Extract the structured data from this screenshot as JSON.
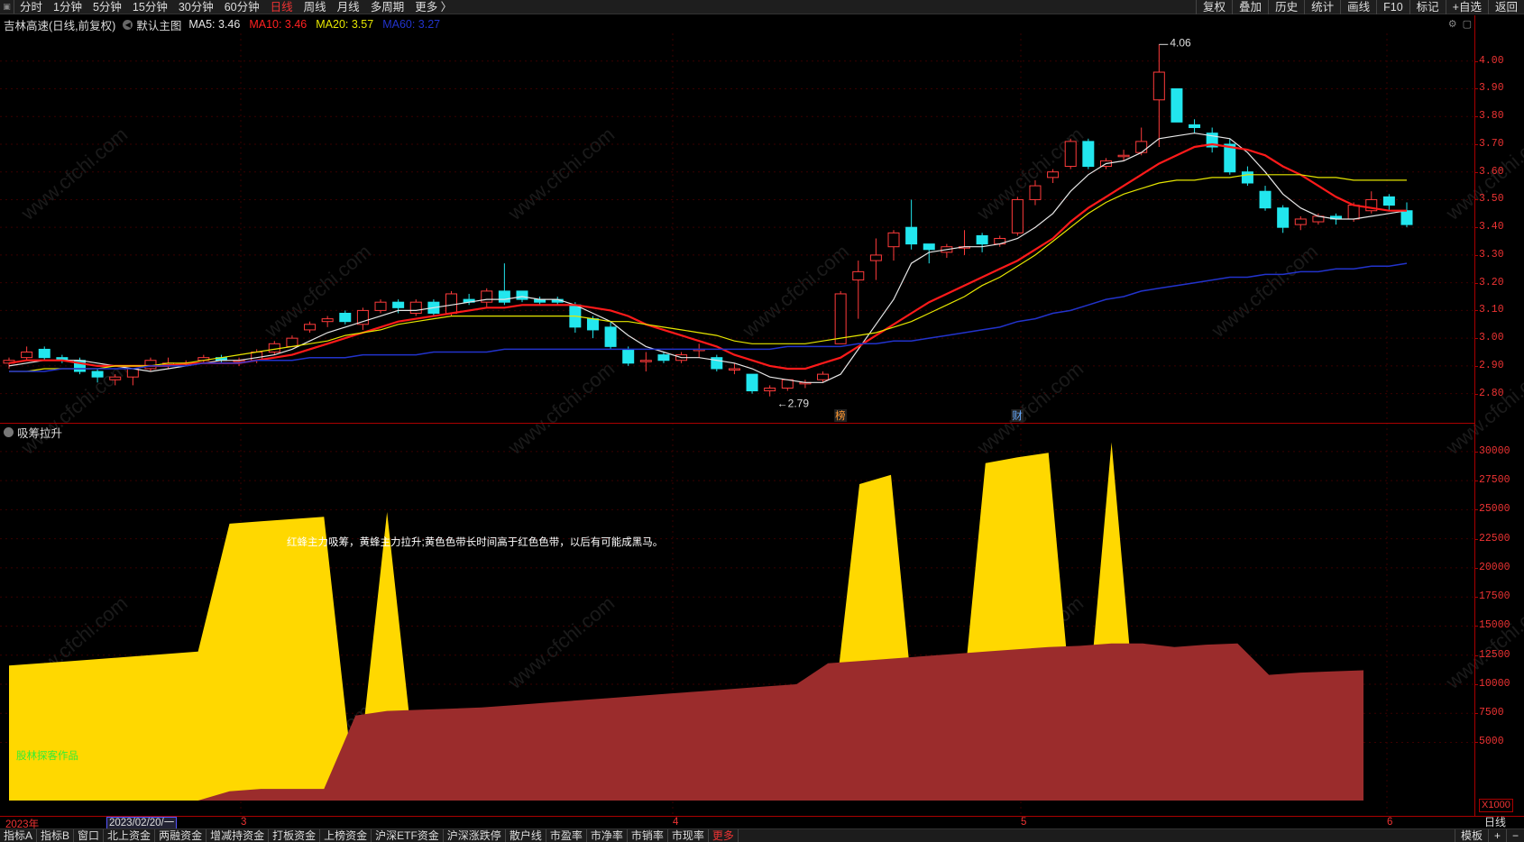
{
  "toolbar": {
    "periods": [
      "分时",
      "1分钟",
      "5分钟",
      "15分钟",
      "30分钟",
      "60分钟",
      "日线",
      "周线",
      "月线",
      "多周期",
      "更多 〉"
    ],
    "active_period": "日线",
    "right_tools": [
      "复权",
      "叠加",
      "历史",
      "统计",
      "画线",
      "F10",
      "标记",
      "+自选",
      "返回"
    ]
  },
  "stock": {
    "title": "吉林高速(日线,前复权)",
    "template": "默认主图",
    "ma": [
      {
        "label": "MA5: 3.46",
        "color": "#e6e6e6"
      },
      {
        "label": "MA10: 3.46",
        "color": "#ff2020"
      },
      {
        "label": "MA20: 3.57",
        "color": "#e6e600"
      },
      {
        "label": "MA60: 3.27",
        "color": "#2233cc"
      }
    ],
    "high_label": "4.06",
    "low_label": "2.79",
    "event_marks": [
      "榜",
      "财"
    ]
  },
  "price_axis": [
    "4.00",
    "3.90",
    "3.80",
    "3.70",
    "3.60",
    "3.50",
    "3.40",
    "3.30",
    "3.20",
    "3.10",
    "3.00",
    "2.90",
    "2.80"
  ],
  "indicator": {
    "name": "吸筹拉升",
    "note": "红蜂主力吸筹，黄蜂主力拉升;黄色色带长时间高于红色色带，以后有可能成黑马。",
    "author": "股林探客作品",
    "axis": [
      "30000",
      "27500",
      "25000",
      "22500",
      "20000",
      "17500",
      "15000",
      "12500",
      "10000",
      "7500",
      "5000"
    ],
    "scale": "X1000"
  },
  "xaxis": {
    "year": "2023年",
    "cursor": "2023/02/20/一",
    "months": [
      "3",
      "4",
      "5",
      "6"
    ]
  },
  "day_label": "日线",
  "bottom_tabs": [
    "指标A",
    "指标B",
    "窗口",
    "北上资金",
    "两融资金",
    "增减持资金",
    "打板资金",
    "上榜资金",
    "沪深ETF资金",
    "沪深涨跌停",
    "散户线",
    "市盈率",
    "市净率",
    "市销率",
    "市现率",
    "更多"
  ],
  "bottom_right": [
    "模板",
    "+",
    "−"
  ],
  "watermark": "www.cfchi.com",
  "chart_data": {
    "type": "candlestick",
    "ylim": [
      2.75,
      4.1
    ],
    "candles": [
      [
        2.91,
        2.92,
        2.89,
        2.93
      ],
      [
        2.93,
        2.95,
        2.92,
        2.97
      ],
      [
        2.96,
        2.93,
        2.92,
        2.97
      ],
      [
        2.93,
        2.92,
        2.91,
        2.94
      ],
      [
        2.92,
        2.88,
        2.87,
        2.93
      ],
      [
        2.88,
        2.86,
        2.84,
        2.89
      ],
      [
        2.85,
        2.86,
        2.83,
        2.87
      ],
      [
        2.86,
        2.89,
        2.83,
        2.89
      ],
      [
        2.89,
        2.92,
        2.88,
        2.93
      ],
      [
        2.91,
        2.91,
        2.89,
        2.93
      ],
      [
        2.91,
        2.91,
        2.9,
        2.92
      ],
      [
        2.92,
        2.93,
        2.91,
        2.94
      ],
      [
        2.93,
        2.92,
        2.91,
        2.94
      ],
      [
        2.92,
        2.92,
        2.9,
        2.93
      ],
      [
        2.92,
        2.95,
        2.91,
        2.96
      ],
      [
        2.95,
        2.98,
        2.94,
        2.99
      ],
      [
        2.97,
        3.0,
        2.97,
        3.01
      ],
      [
        3.03,
        3.05,
        3.02,
        3.06
      ],
      [
        3.06,
        3.07,
        3.04,
        3.08
      ],
      [
        3.09,
        3.06,
        3.05,
        3.1
      ],
      [
        3.05,
        3.1,
        3.03,
        3.11
      ],
      [
        3.1,
        3.13,
        3.09,
        3.14
      ],
      [
        3.13,
        3.11,
        3.09,
        3.14
      ],
      [
        3.09,
        3.13,
        3.08,
        3.14
      ],
      [
        3.13,
        3.09,
        3.08,
        3.14
      ],
      [
        3.09,
        3.16,
        3.08,
        3.17
      ],
      [
        3.14,
        3.13,
        3.12,
        3.16
      ],
      [
        3.13,
        3.17,
        3.11,
        3.18
      ],
      [
        3.17,
        3.13,
        3.12,
        3.27
      ],
      [
        3.17,
        3.14,
        3.13,
        3.17
      ],
      [
        3.14,
        3.13,
        3.12,
        3.15
      ],
      [
        3.14,
        3.13,
        3.12,
        3.15
      ],
      [
        3.12,
        3.04,
        3.02,
        3.13
      ],
      [
        3.07,
        3.03,
        3.0,
        3.08
      ],
      [
        3.04,
        2.97,
        2.96,
        3.06
      ],
      [
        2.96,
        2.91,
        2.9,
        2.97
      ],
      [
        2.92,
        2.92,
        2.88,
        2.95
      ],
      [
        2.94,
        2.92,
        2.91,
        2.95
      ],
      [
        2.92,
        2.94,
        2.91,
        2.95
      ],
      [
        2.96,
        2.96,
        2.93,
        2.98
      ],
      [
        2.93,
        2.89,
        2.88,
        2.94
      ],
      [
        2.89,
        2.89,
        2.87,
        2.91
      ],
      [
        2.87,
        2.81,
        2.8,
        2.87
      ],
      [
        2.81,
        2.82,
        2.79,
        2.83
      ],
      [
        2.82,
        2.85,
        2.81,
        2.85
      ],
      [
        2.84,
        2.84,
        2.82,
        2.85
      ],
      [
        2.85,
        2.87,
        2.84,
        2.88
      ],
      [
        2.98,
        3.16,
        2.98,
        3.17
      ],
      [
        3.21,
        3.24,
        3.07,
        3.28
      ],
      [
        3.28,
        3.3,
        3.21,
        3.36
      ],
      [
        3.33,
        3.38,
        3.28,
        3.39
      ],
      [
        3.4,
        3.34,
        3.32,
        3.5
      ],
      [
        3.34,
        3.32,
        3.27,
        3.34
      ],
      [
        3.31,
        3.33,
        3.29,
        3.34
      ],
      [
        3.33,
        3.33,
        3.3,
        3.39
      ],
      [
        3.37,
        3.34,
        3.31,
        3.38
      ],
      [
        3.34,
        3.36,
        3.33,
        3.37
      ],
      [
        3.38,
        3.5,
        3.37,
        3.51
      ],
      [
        3.5,
        3.55,
        3.48,
        3.57
      ],
      [
        3.58,
        3.6,
        3.56,
        3.61
      ],
      [
        3.62,
        3.71,
        3.61,
        3.72
      ],
      [
        3.71,
        3.62,
        3.61,
        3.72
      ],
      [
        3.62,
        3.64,
        3.61,
        3.65
      ],
      [
        3.66,
        3.66,
        3.64,
        3.68
      ],
      [
        3.67,
        3.71,
        3.66,
        3.76
      ],
      [
        3.86,
        3.96,
        3.69,
        4.06
      ],
      [
        3.9,
        3.78,
        3.78,
        3.9
      ],
      [
        3.77,
        3.76,
        3.74,
        3.79
      ],
      [
        3.74,
        3.69,
        3.67,
        3.76
      ],
      [
        3.7,
        3.6,
        3.59,
        3.72
      ],
      [
        3.6,
        3.56,
        3.55,
        3.62
      ],
      [
        3.53,
        3.47,
        3.46,
        3.55
      ],
      [
        3.47,
        3.4,
        3.38,
        3.48
      ],
      [
        3.41,
        3.43,
        3.39,
        3.44
      ],
      [
        3.42,
        3.44,
        3.41,
        3.45
      ],
      [
        3.44,
        3.43,
        3.41,
        3.45
      ],
      [
        3.43,
        3.48,
        3.42,
        3.49
      ],
      [
        3.46,
        3.5,
        3.45,
        3.53
      ],
      [
        3.51,
        3.48,
        3.46,
        3.52
      ],
      [
        3.46,
        3.41,
        3.4,
        3.49
      ]
    ],
    "series": [
      {
        "name": "MA5",
        "values": [
          2.9,
          2.91,
          2.92,
          2.92,
          2.92,
          2.91,
          2.9,
          2.89,
          2.88,
          2.89,
          2.9,
          2.91,
          2.92,
          2.92,
          2.93,
          2.94,
          2.96,
          2.99,
          3.02,
          3.04,
          3.06,
          3.08,
          3.1,
          3.1,
          3.11,
          3.12,
          3.13,
          3.14,
          3.14,
          3.15,
          3.14,
          3.14,
          3.12,
          3.09,
          3.06,
          3.01,
          2.97,
          2.95,
          2.93,
          2.93,
          2.92,
          2.91,
          2.89,
          2.86,
          2.85,
          2.84,
          2.84,
          2.87,
          2.96,
          3.05,
          3.14,
          3.27,
          3.31,
          3.32,
          3.33,
          3.33,
          3.34,
          3.36,
          3.4,
          3.45,
          3.53,
          3.59,
          3.63,
          3.64,
          3.67,
          3.72,
          3.73,
          3.74,
          3.73,
          3.72,
          3.67,
          3.6,
          3.52,
          3.47,
          3.44,
          3.43,
          3.43,
          3.44,
          3.45,
          3.46
        ]
      },
      {
        "name": "MA10",
        "values": [
          2.91,
          2.92,
          2.92,
          2.92,
          2.91,
          2.9,
          2.9,
          2.9,
          2.9,
          2.9,
          2.91,
          2.91,
          2.91,
          2.91,
          2.92,
          2.93,
          2.94,
          2.96,
          2.98,
          3.0,
          3.02,
          3.04,
          3.06,
          3.07,
          3.08,
          3.09,
          3.1,
          3.11,
          3.11,
          3.12,
          3.12,
          3.12,
          3.12,
          3.11,
          3.1,
          3.08,
          3.05,
          3.03,
          3.01,
          2.99,
          2.97,
          2.94,
          2.92,
          2.9,
          2.89,
          2.89,
          2.91,
          2.93,
          2.97,
          3.01,
          3.05,
          3.09,
          3.13,
          3.16,
          3.19,
          3.22,
          3.25,
          3.28,
          3.32,
          3.36,
          3.42,
          3.47,
          3.51,
          3.55,
          3.59,
          3.63,
          3.66,
          3.69,
          3.7,
          3.69,
          3.68,
          3.66,
          3.62,
          3.59,
          3.55,
          3.51,
          3.48,
          3.47,
          3.46,
          3.46
        ]
      },
      {
        "name": "MA20",
        "values": [
          2.88,
          2.88,
          2.89,
          2.89,
          2.89,
          2.89,
          2.9,
          2.9,
          2.9,
          2.91,
          2.91,
          2.92,
          2.93,
          2.94,
          2.95,
          2.96,
          2.97,
          2.98,
          2.99,
          3.01,
          3.02,
          3.03,
          3.05,
          3.06,
          3.07,
          3.08,
          3.08,
          3.08,
          3.08,
          3.08,
          3.08,
          3.08,
          3.08,
          3.07,
          3.06,
          3.06,
          3.05,
          3.04,
          3.03,
          3.02,
          3.01,
          2.99,
          2.98,
          2.98,
          2.98,
          2.98,
          2.99,
          3.0,
          3.01,
          3.02,
          3.04,
          3.06,
          3.09,
          3.12,
          3.15,
          3.19,
          3.22,
          3.26,
          3.3,
          3.35,
          3.4,
          3.45,
          3.49,
          3.52,
          3.54,
          3.56,
          3.57,
          3.57,
          3.58,
          3.58,
          3.59,
          3.59,
          3.59,
          3.59,
          3.58,
          3.58,
          3.57,
          3.57,
          3.57,
          3.57
        ]
      },
      {
        "name": "MA60",
        "values": [
          2.88,
          2.88,
          2.88,
          2.89,
          2.89,
          2.89,
          2.89,
          2.89,
          2.9,
          2.9,
          2.9,
          2.91,
          2.91,
          2.91,
          2.92,
          2.92,
          2.92,
          2.93,
          2.93,
          2.93,
          2.94,
          2.94,
          2.94,
          2.94,
          2.95,
          2.95,
          2.95,
          2.95,
          2.96,
          2.96,
          2.96,
          2.96,
          2.96,
          2.96,
          2.96,
          2.96,
          2.96,
          2.96,
          2.96,
          2.96,
          2.96,
          2.96,
          2.96,
          2.96,
          2.97,
          2.97,
          2.97,
          2.97,
          2.98,
          2.98,
          2.99,
          2.99,
          3.0,
          3.01,
          3.02,
          3.03,
          3.04,
          3.06,
          3.07,
          3.09,
          3.1,
          3.12,
          3.14,
          3.15,
          3.17,
          3.18,
          3.19,
          3.2,
          3.21,
          3.22,
          3.22,
          3.23,
          3.23,
          3.24,
          3.24,
          3.25,
          3.25,
          3.26,
          3.26,
          3.27
        ]
      }
    ],
    "indicator_ylim": [
      0,
      31000
    ],
    "indicator_series": [
      {
        "values": [
          11600,
          11800,
          12000,
          12200,
          12400,
          12600,
          12800,
          23800,
          24000,
          24200,
          24400,
          0,
          24800,
          0,
          800,
          1000,
          1200,
          1400,
          1600,
          1800,
          2000,
          2200,
          2400,
          2600,
          2800,
          3000,
          3200,
          27200,
          28000,
          0,
          800,
          29000,
          29500,
          29900,
          0,
          30800,
          0,
          1600,
          2000,
          2400,
          2800,
          3200,
          3600,
          3800
        ]
      },
      {
        "values": [
          0,
          0,
          0,
          0,
          0,
          0,
          0,
          800,
          1000,
          1000,
          1000,
          7300,
          7700,
          7800,
          7900,
          8000,
          8200,
          8400,
          8600,
          8800,
          9000,
          9200,
          9400,
          9600,
          9800,
          10000,
          11800,
          12000,
          12200,
          12400,
          12600,
          12800,
          13000,
          13200,
          13300,
          13500,
          13500,
          13200,
          13400,
          13500,
          10800,
          11000,
          11100,
          11200
        ]
      }
    ]
  }
}
